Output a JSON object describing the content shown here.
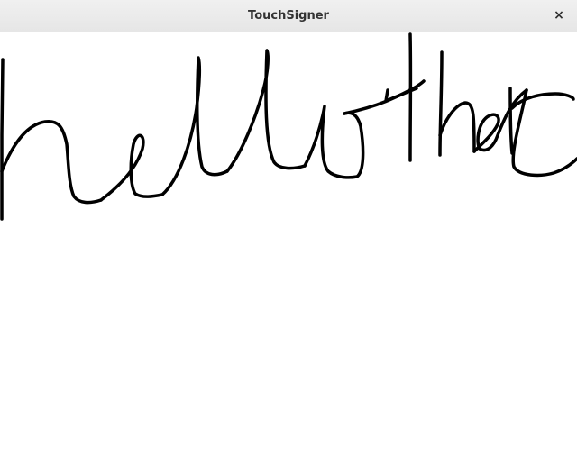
{
  "window": {
    "title": "TouchSigner",
    "close_icon": "close-icon",
    "close_glyph": "×"
  },
  "signature_canvas": {
    "stroke_color": "#000000",
    "background_color": "#ffffff"
  }
}
